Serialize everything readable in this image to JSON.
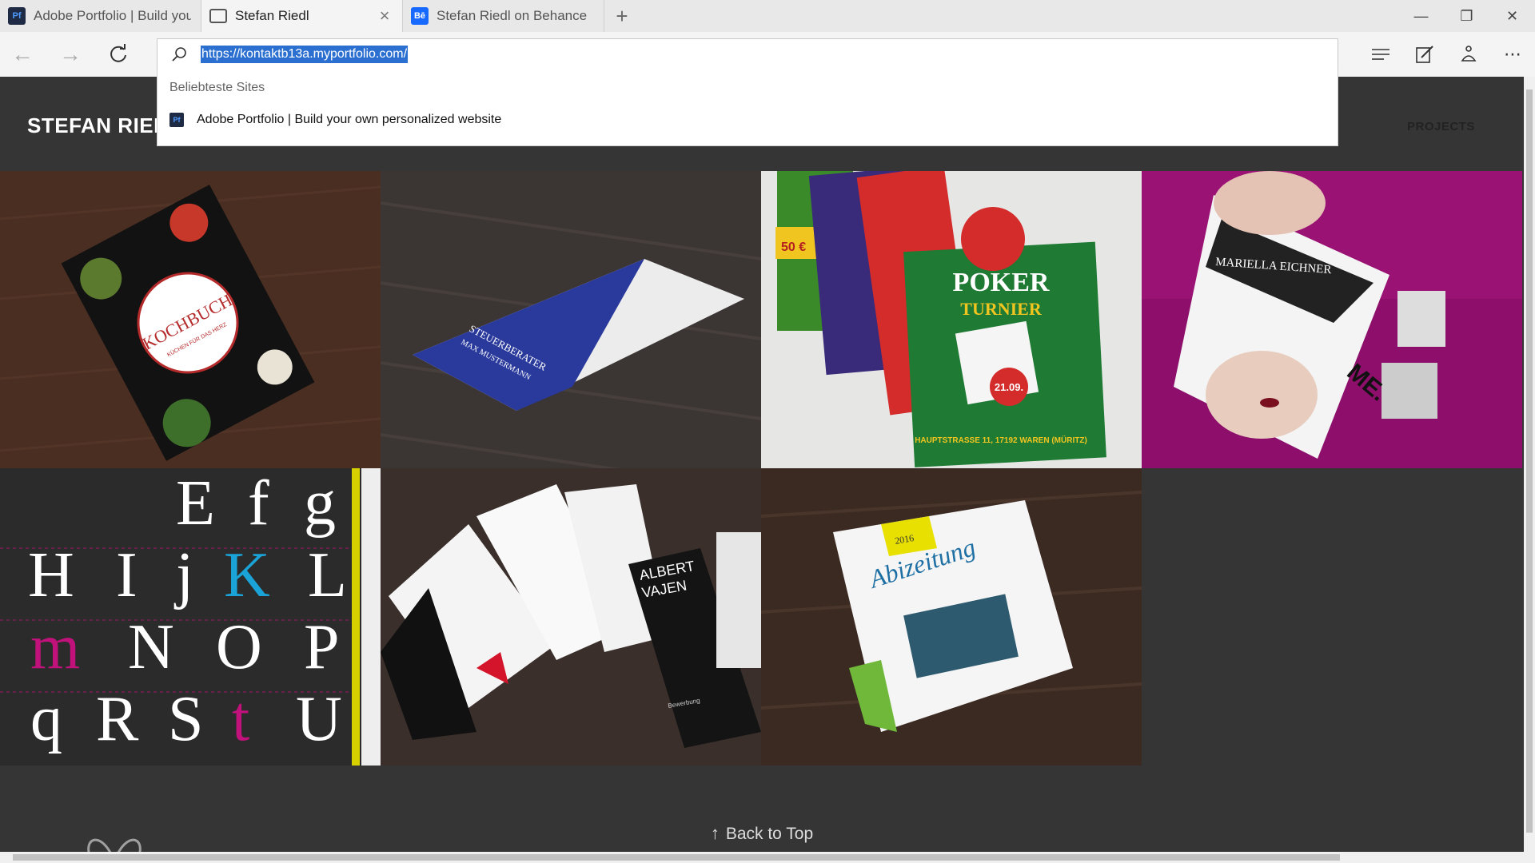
{
  "tabs": [
    {
      "title": "Adobe Portfolio | Build your",
      "favicon": "Pf"
    },
    {
      "title": "Stefan Riedl",
      "favicon": "page-icon"
    },
    {
      "title": "Stefan Riedl on Behance",
      "favicon": "Bē"
    }
  ],
  "address": {
    "url": "https://kontaktb13a.myportfolio.com/"
  },
  "dropdown": {
    "header": "Beliebteste Sites",
    "item": "Adobe Portfolio | Build your own personalized website",
    "item_favicon": "Pf"
  },
  "site": {
    "title": "STEFAN RIEDL",
    "nav_projects": "PROJECTS"
  },
  "projects": [
    {
      "name": "kochbuch",
      "texts": [
        "KOCHBUCH",
        "KÜCHEN FÜR DAS HERZ"
      ]
    },
    {
      "name": "steuerberater",
      "texts": [
        "STEUERBERATER",
        "MAX MUSTERMANN"
      ]
    },
    {
      "name": "poker-turnier",
      "texts": [
        "POKER",
        "TURNIER",
        "21.09.",
        "HAUPTSTRASSE 11, 17192 WAREN (MÜRITZ)",
        "50 €"
      ]
    },
    {
      "name": "mariella-eichner",
      "texts": [
        "MARIELLA EICHNER",
        "ME."
      ]
    },
    {
      "name": "typography",
      "texts": [
        "E",
        "f",
        "g",
        "H",
        "I",
        "j",
        "K",
        "L",
        "m",
        "N",
        "O",
        "P",
        "q",
        "R",
        "S",
        "t",
        "U"
      ]
    },
    {
      "name": "albert-vajen",
      "texts": [
        "ALBERT",
        "VAJEN",
        "Bewerbung"
      ]
    },
    {
      "name": "abizeitung",
      "texts": [
        "Abizeitung",
        "2016"
      ]
    }
  ],
  "back_to_top": "Back to Top",
  "colors": {
    "accent_magenta": "#c0127a",
    "selection_blue": "#2b6fd0",
    "page_bg": "#353535"
  }
}
